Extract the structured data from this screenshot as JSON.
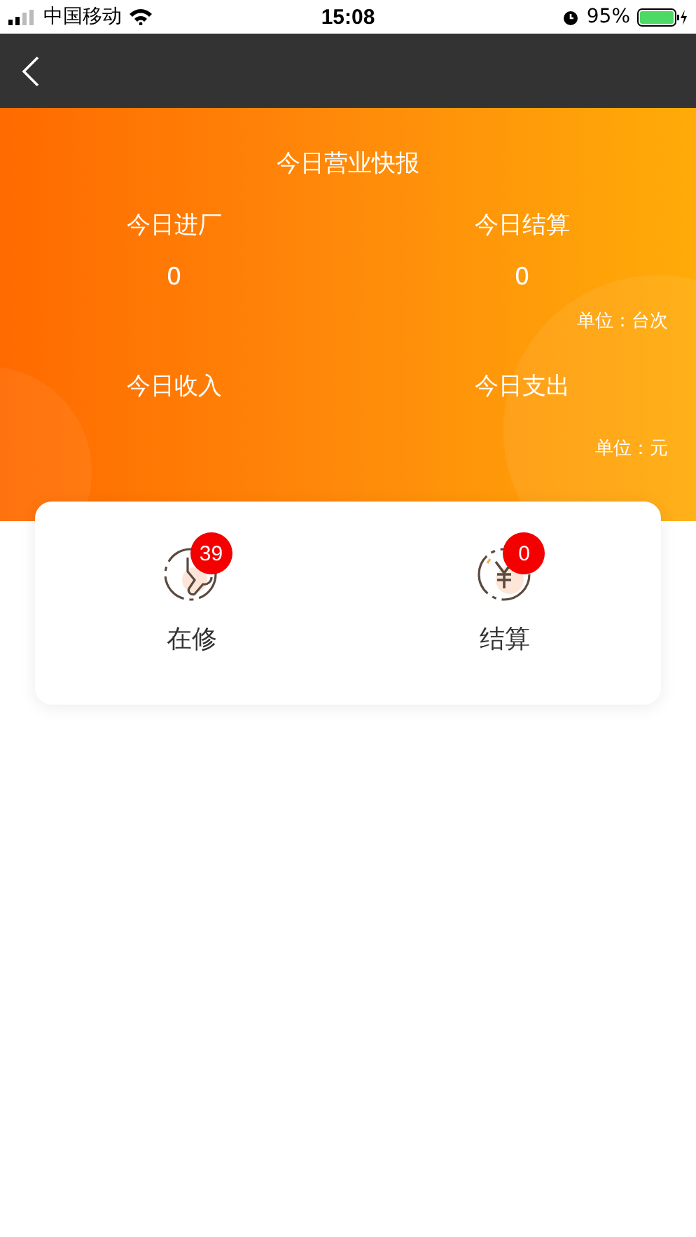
{
  "status_bar": {
    "carrier": "中国移动",
    "time": "15:08",
    "battery": "95%"
  },
  "report": {
    "title": "今日营业快报",
    "groups": [
      {
        "items": [
          {
            "label": "今日进厂",
            "value": "0"
          },
          {
            "label": "今日结算",
            "value": "0"
          }
        ],
        "unit": "单位：台次"
      },
      {
        "items": [
          {
            "label": "今日收入"
          },
          {
            "label": "今日支出"
          }
        ],
        "unit": "单位：元"
      }
    ]
  },
  "shortcuts": [
    {
      "kind": "wrench",
      "label": "在修",
      "badge": "39"
    },
    {
      "kind": "yen",
      "label": "结算",
      "badge": "0"
    }
  ]
}
